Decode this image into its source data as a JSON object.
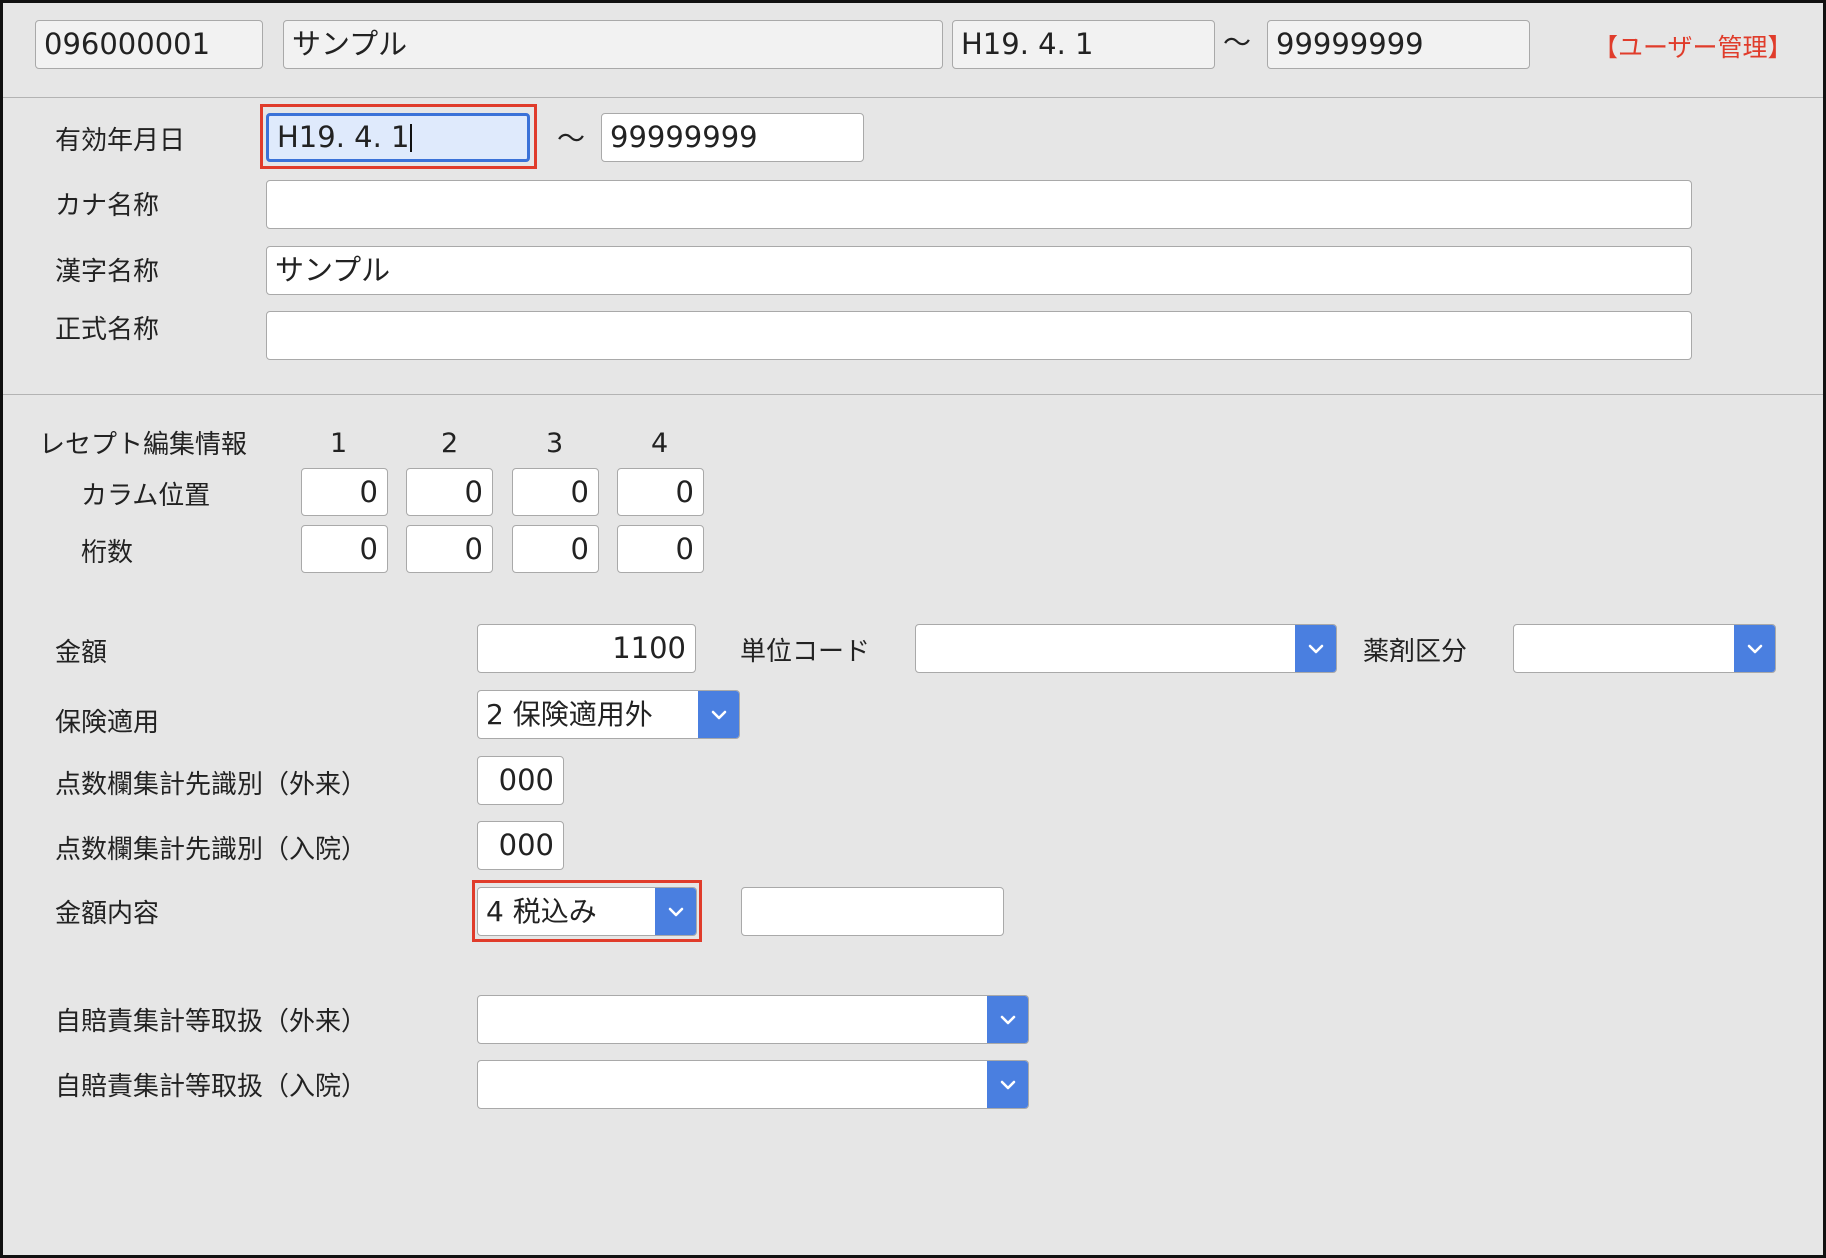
{
  "header": {
    "code": "096000001",
    "name": "サンプル",
    "start_date": "H19. 4. 1",
    "tilde": "〜",
    "end_date": "99999999",
    "mode_badge": "【ユーザー管理】",
    "mode_badge_color": "#e03c2b"
  },
  "basic": {
    "valid_date_label": "有効年月日",
    "valid_from": "H19. 4. 1",
    "tilde": "〜",
    "valid_to": "99999999",
    "kana_label": "カナ名称",
    "kana_value": "",
    "kanji_label": "漢字名称",
    "kanji_value": "サンプル",
    "formal_label": "正式名称",
    "formal_value": ""
  },
  "receipt": {
    "title": "レセプト編集情報",
    "col_headers": [
      "1",
      "2",
      "3",
      "4"
    ],
    "column_pos_label": "カラム位置",
    "column_pos_values": [
      "0",
      "0",
      "0",
      "0"
    ],
    "digits_label": "桁数",
    "digits_values": [
      "0",
      "0",
      "0",
      "0"
    ]
  },
  "detail": {
    "amount_label": "金額",
    "amount_value": "1100",
    "unit_code_label": "単位コード",
    "unit_code_value": "",
    "drug_class_label": "薬剤区分",
    "drug_class_value": "",
    "insurance_label": "保険適用",
    "insurance_value": "2 保険適用外",
    "score_out_label": "点数欄集計先識別（外来）",
    "score_out_value": "000",
    "score_in_label": "点数欄集計先識別（入院）",
    "score_in_value": "000",
    "amount_content_label": "金額内容",
    "amount_content_value": "4 税込み",
    "amount_content_extra": "",
    "auto_out_label": "自賠責集計等取扱（外来）",
    "auto_out_value": "",
    "auto_in_label": "自賠責集計等取扱（入院）",
    "auto_in_value": ""
  },
  "icons": {
    "dropdown": "chevron-down-icon"
  },
  "colors": {
    "accent": "#4a7fe0",
    "highlight": "#e03c2b",
    "focus": "#3b72d8"
  }
}
